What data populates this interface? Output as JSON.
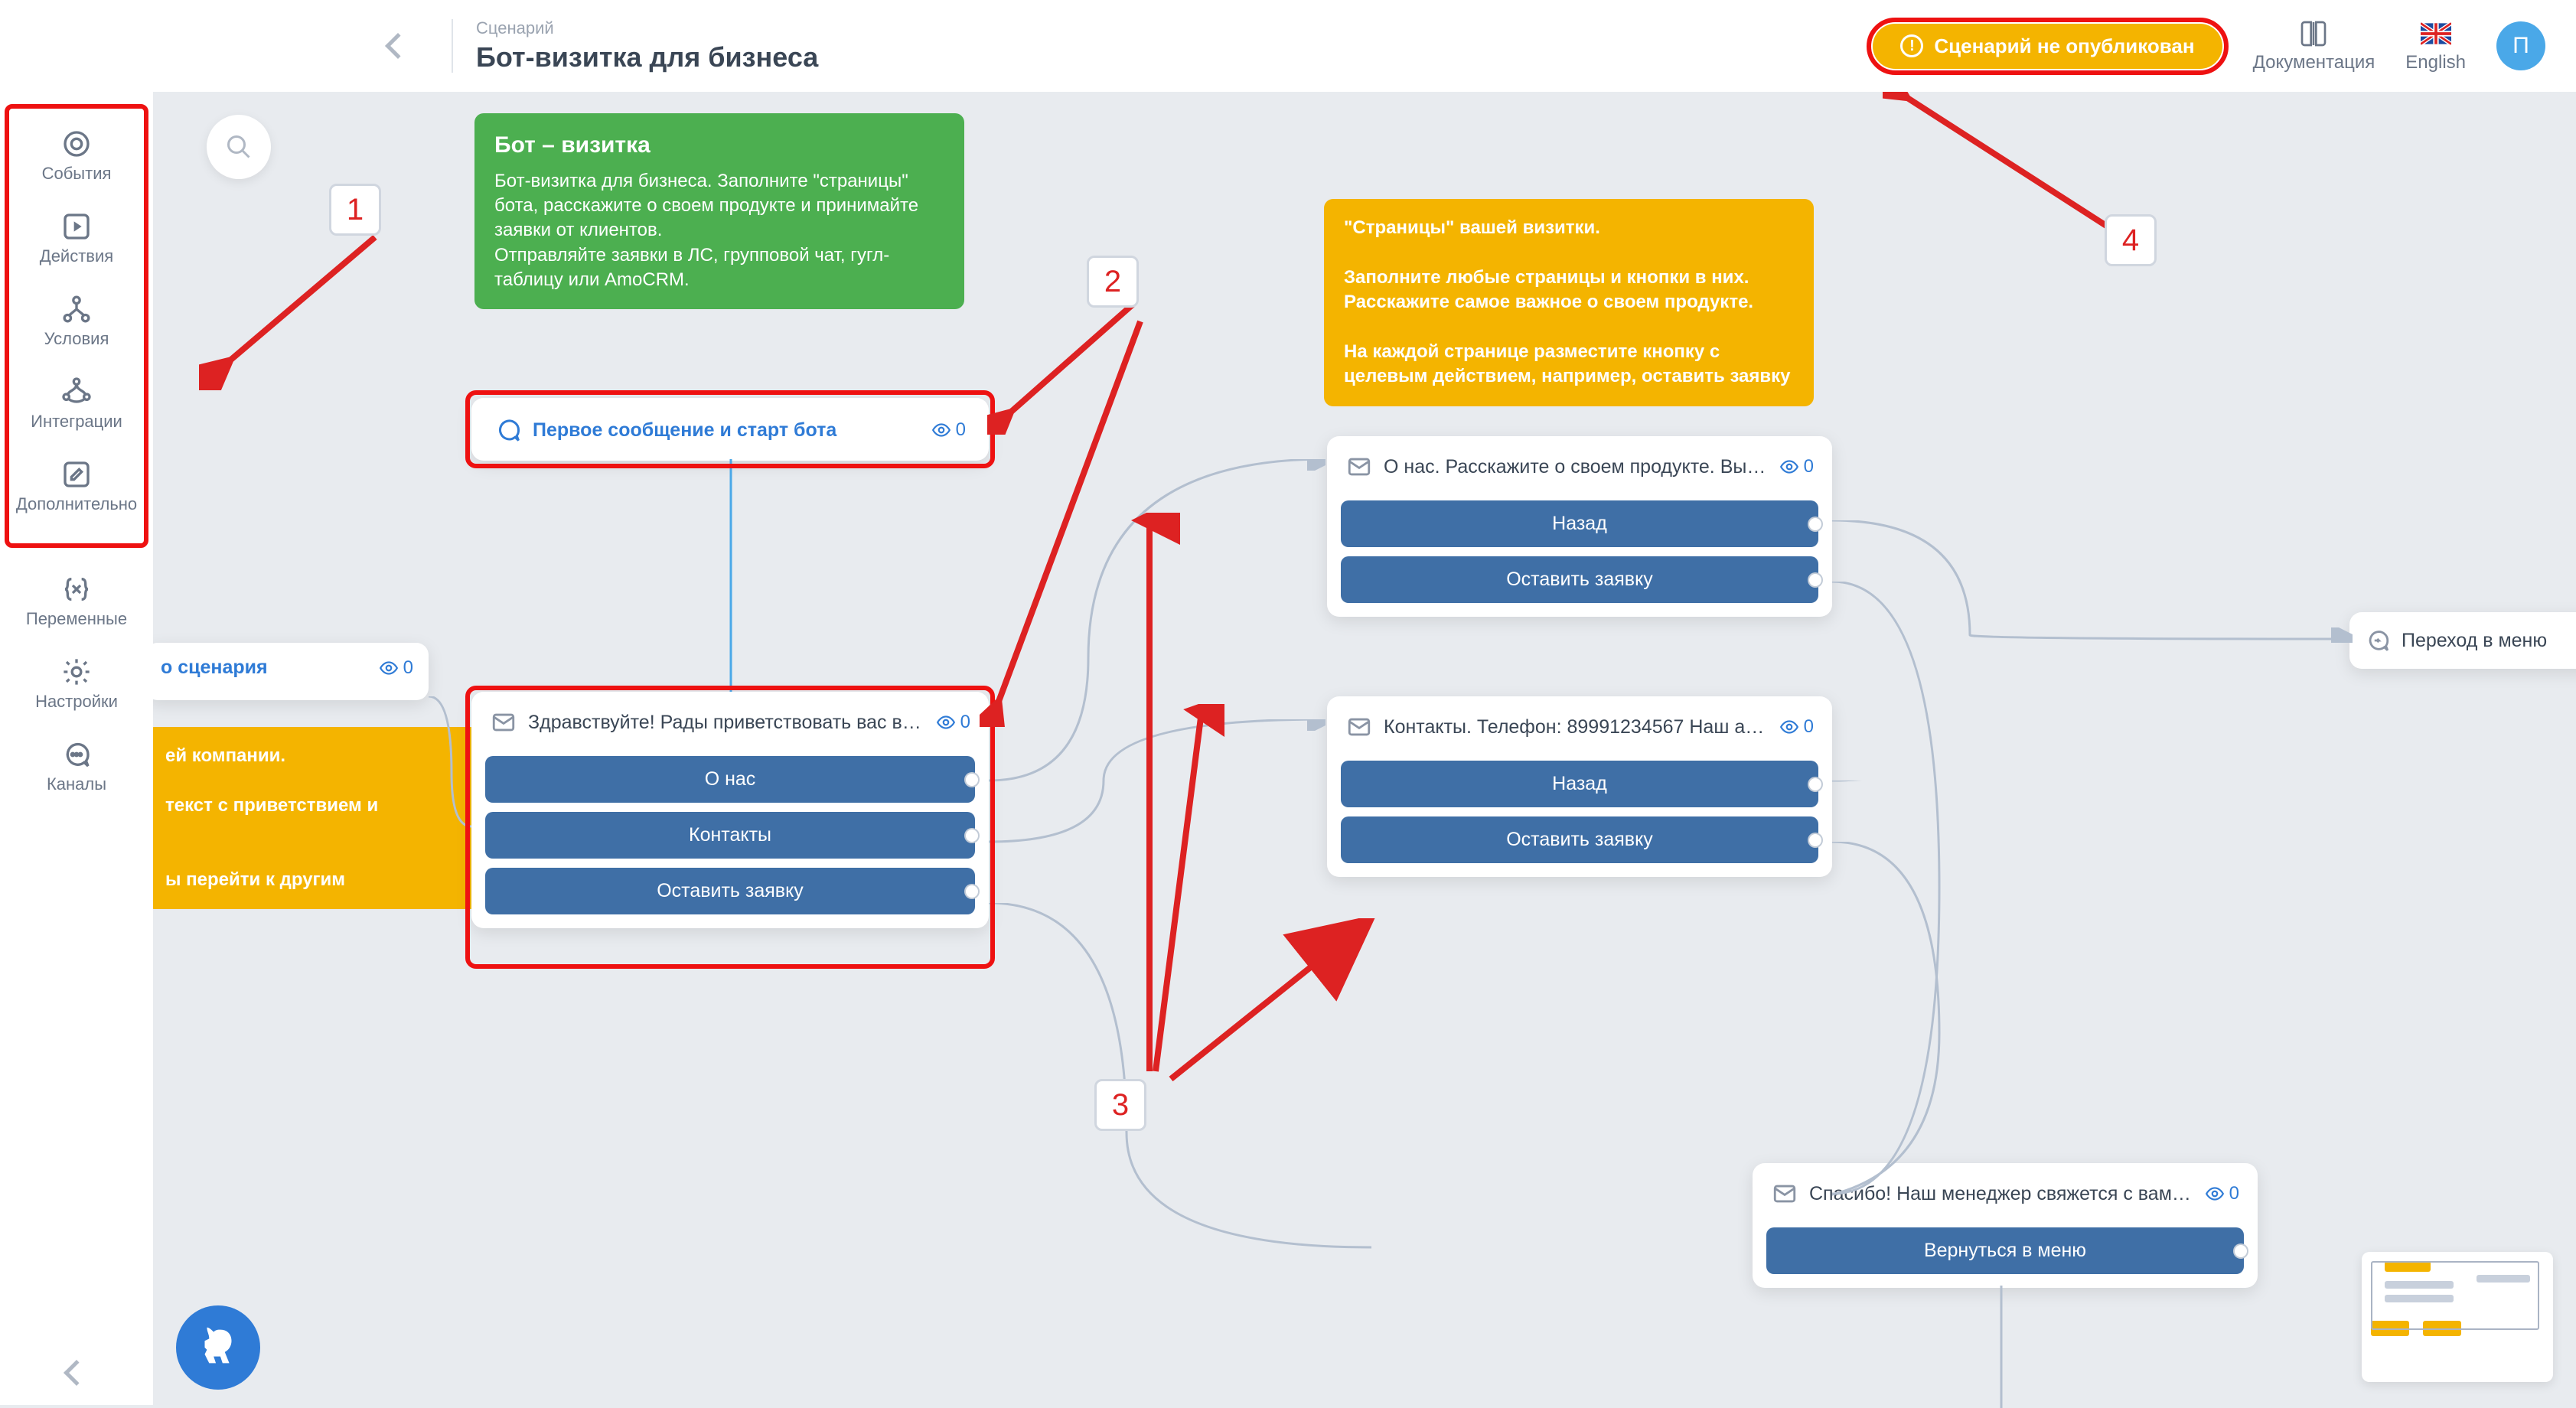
{
  "header": {
    "breadcrumb": "Сценарий",
    "title": "Бот-визитка для бизнеса",
    "publish_status": "Сценарий не опубликован",
    "docs": "Документация",
    "lang": "English",
    "avatar_initial": "П"
  },
  "sidebar": {
    "items": [
      {
        "id": "events",
        "label": "События"
      },
      {
        "id": "actions",
        "label": "Действия"
      },
      {
        "id": "conditions",
        "label": "Условия"
      },
      {
        "id": "integrations",
        "label": "Интеграции"
      },
      {
        "id": "additional",
        "label": "Дополнительно"
      }
    ],
    "items2": [
      {
        "id": "variables",
        "label": "Переменные"
      },
      {
        "id": "settings",
        "label": "Настройки"
      },
      {
        "id": "channels",
        "label": "Каналы"
      }
    ]
  },
  "notes": {
    "green": {
      "title": "Бот – визитка",
      "body": "Бот-визитка для бизнеса. Заполните \"страницы\" бота, расскажите о своем продукте и принимайте заявки от клиентов.\nОтправляйте заявки в ЛС, групповой чат, гугл-таблицу или AmoCRM."
    },
    "yellow1": {
      "body": "\"Страницы\" вашей визитки.\n\nЗаполните любые страницы и кнопки в них. Расскажите самое важное о своем продукте.\n\nНа каждой странице разместите кнопку с целевым действием, например, оставить заявку"
    },
    "yellow_left": {
      "line1": "ей компании.",
      "line2": "текст с приветствием и",
      "line3": "ы перейти к другим"
    }
  },
  "cards": {
    "start": {
      "title": "Первое сообщение и старт бота",
      "count": "0"
    },
    "scenario_cut": {
      "title": "о сценария",
      "count": "0"
    },
    "hello": {
      "title": "Здравствуйте! Рады приветствовать вас в …",
      "count": "0",
      "buttons": [
        "О нас",
        "Контакты",
        "Оставить заявку"
      ]
    },
    "about": {
      "title": "О нас. Расскажите о своем продукте. Вы м…",
      "count": "0",
      "buttons": [
        "Назад",
        "Оставить заявку"
      ]
    },
    "contacts": {
      "title": "Контакты. Телефон: 89991234567 Наш адр…",
      "count": "0",
      "buttons": [
        "Назад",
        "Оставить заявку"
      ]
    },
    "thanks": {
      "title": "Спасибо! Наш менеджер свяжется с вами в…",
      "count": "0",
      "buttons": [
        "Вернуться в меню"
      ]
    },
    "menu": {
      "title": "Переход в меню"
    }
  },
  "annotations": {
    "n1": "1",
    "n2": "2",
    "n3": "3",
    "n4": "4"
  }
}
